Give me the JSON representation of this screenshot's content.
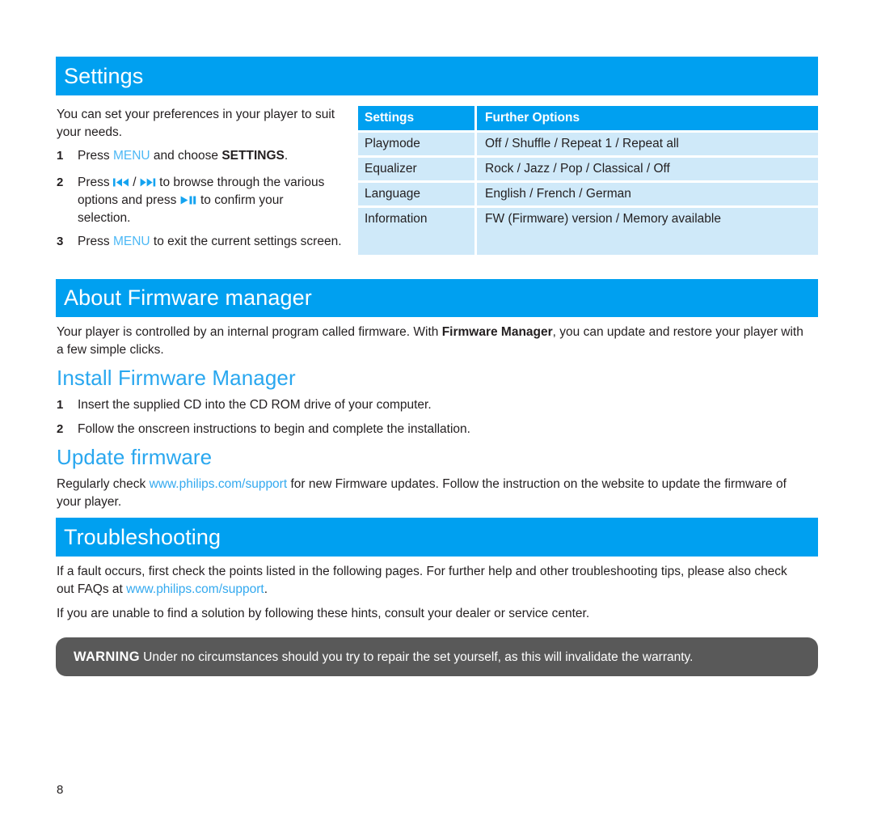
{
  "page": {
    "number": "8",
    "accent_blue": "#00a0f0",
    "light_blue": "#cfe9f9",
    "link_blue": "#33a9ef",
    "warn_gray": "#595959"
  },
  "settings_section": {
    "banner_title": "Settings",
    "intro": "You can set your preferences in your player to suit your needs.",
    "steps": [
      {
        "num": "1",
        "pre": "Press ",
        "menu": "MENU",
        "mid": " and choose ",
        "bold": "SETTINGS",
        "post": "."
      },
      {
        "num": "2",
        "pre": "Press ",
        "icon_prev": "previous-track-icon",
        "sep": " / ",
        "icon_next": "next-track-icon",
        "mid": " to browse through the various options and press ",
        "icon_play": "play-pause-icon",
        "post": " to confirm your selection."
      },
      {
        "num": "3",
        "pre": "Press ",
        "menu": "MENU",
        "post": " to exit the current settings screen."
      }
    ],
    "table": {
      "headers": [
        "Settings",
        "Further Options"
      ],
      "rows": [
        [
          "Playmode",
          "Off  / Shuffle / Repeat 1 / Repeat all"
        ],
        [
          "Equalizer",
          "Rock / Jazz / Pop / Classical / Off"
        ],
        [
          "Language",
          "English / French / German"
        ],
        [
          "Information",
          "FW (Firmware) version / Memory available"
        ]
      ]
    }
  },
  "firmware_section": {
    "banner_title": "About Firmware manager",
    "intro_pre": "Your player is controlled by an internal program called firmware. With ",
    "intro_bold": "Firmware Manager",
    "intro_post": ", you can update and restore your player with a few simple clicks.",
    "install_heading": "Install Firmware Manager",
    "install_steps": [
      {
        "num": "1",
        "text": "Insert the supplied CD into the CD ROM drive of your computer."
      },
      {
        "num": "2",
        "text": "Follow the onscreen instructions to begin and complete the installation."
      }
    ],
    "update_heading": "Update firmware",
    "update_pre": "Regularly check ",
    "update_link": "www.philips.com/support",
    "update_post": " for new Firmware updates. Follow the instruction on the website to update the firmware of your player."
  },
  "troubleshooting_section": {
    "banner_title": "Troubleshooting",
    "para1_pre": "If a fault occurs, first check the points listed in the following pages. For further help and other troubleshooting tips, please also check out FAQs at ",
    "para1_link": "www.philips.com/support",
    "para1_post": ".",
    "para2": "If you are unable to find a solution by following these hints, consult your dealer or service center."
  },
  "warning": {
    "label": "WARNING",
    "text": " Under no circumstances should you try to repair the set yourself, as this will invalidate the warranty."
  }
}
